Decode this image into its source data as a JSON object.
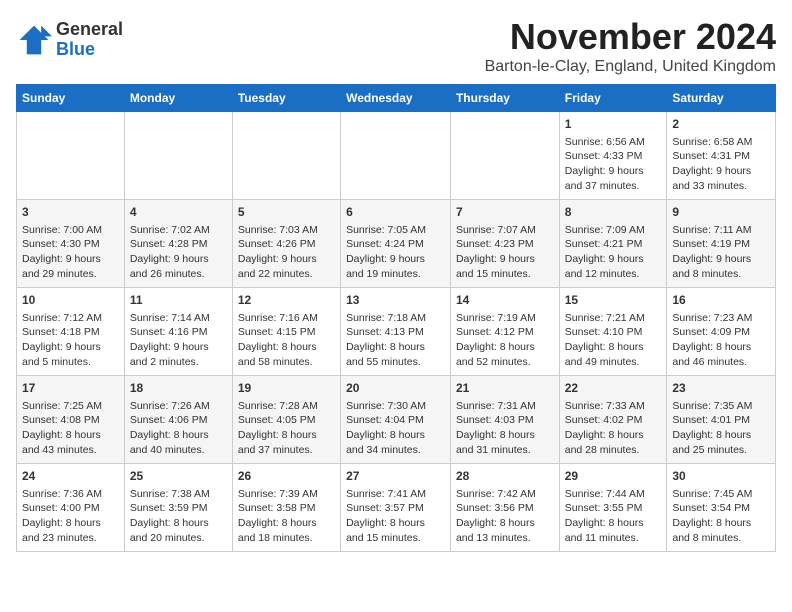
{
  "header": {
    "logo_general": "General",
    "logo_blue": "Blue",
    "month_title": "November 2024",
    "location": "Barton-le-Clay, England, United Kingdom"
  },
  "days_of_week": [
    "Sunday",
    "Monday",
    "Tuesday",
    "Wednesday",
    "Thursday",
    "Friday",
    "Saturday"
  ],
  "weeks": [
    [
      {
        "day": "",
        "info": ""
      },
      {
        "day": "",
        "info": ""
      },
      {
        "day": "",
        "info": ""
      },
      {
        "day": "",
        "info": ""
      },
      {
        "day": "",
        "info": ""
      },
      {
        "day": "1",
        "info": "Sunrise: 6:56 AM\nSunset: 4:33 PM\nDaylight: 9 hours and 37 minutes."
      },
      {
        "day": "2",
        "info": "Sunrise: 6:58 AM\nSunset: 4:31 PM\nDaylight: 9 hours and 33 minutes."
      }
    ],
    [
      {
        "day": "3",
        "info": "Sunrise: 7:00 AM\nSunset: 4:30 PM\nDaylight: 9 hours and 29 minutes."
      },
      {
        "day": "4",
        "info": "Sunrise: 7:02 AM\nSunset: 4:28 PM\nDaylight: 9 hours and 26 minutes."
      },
      {
        "day": "5",
        "info": "Sunrise: 7:03 AM\nSunset: 4:26 PM\nDaylight: 9 hours and 22 minutes."
      },
      {
        "day": "6",
        "info": "Sunrise: 7:05 AM\nSunset: 4:24 PM\nDaylight: 9 hours and 19 minutes."
      },
      {
        "day": "7",
        "info": "Sunrise: 7:07 AM\nSunset: 4:23 PM\nDaylight: 9 hours and 15 minutes."
      },
      {
        "day": "8",
        "info": "Sunrise: 7:09 AM\nSunset: 4:21 PM\nDaylight: 9 hours and 12 minutes."
      },
      {
        "day": "9",
        "info": "Sunrise: 7:11 AM\nSunset: 4:19 PM\nDaylight: 9 hours and 8 minutes."
      }
    ],
    [
      {
        "day": "10",
        "info": "Sunrise: 7:12 AM\nSunset: 4:18 PM\nDaylight: 9 hours and 5 minutes."
      },
      {
        "day": "11",
        "info": "Sunrise: 7:14 AM\nSunset: 4:16 PM\nDaylight: 9 hours and 2 minutes."
      },
      {
        "day": "12",
        "info": "Sunrise: 7:16 AM\nSunset: 4:15 PM\nDaylight: 8 hours and 58 minutes."
      },
      {
        "day": "13",
        "info": "Sunrise: 7:18 AM\nSunset: 4:13 PM\nDaylight: 8 hours and 55 minutes."
      },
      {
        "day": "14",
        "info": "Sunrise: 7:19 AM\nSunset: 4:12 PM\nDaylight: 8 hours and 52 minutes."
      },
      {
        "day": "15",
        "info": "Sunrise: 7:21 AM\nSunset: 4:10 PM\nDaylight: 8 hours and 49 minutes."
      },
      {
        "day": "16",
        "info": "Sunrise: 7:23 AM\nSunset: 4:09 PM\nDaylight: 8 hours and 46 minutes."
      }
    ],
    [
      {
        "day": "17",
        "info": "Sunrise: 7:25 AM\nSunset: 4:08 PM\nDaylight: 8 hours and 43 minutes."
      },
      {
        "day": "18",
        "info": "Sunrise: 7:26 AM\nSunset: 4:06 PM\nDaylight: 8 hours and 40 minutes."
      },
      {
        "day": "19",
        "info": "Sunrise: 7:28 AM\nSunset: 4:05 PM\nDaylight: 8 hours and 37 minutes."
      },
      {
        "day": "20",
        "info": "Sunrise: 7:30 AM\nSunset: 4:04 PM\nDaylight: 8 hours and 34 minutes."
      },
      {
        "day": "21",
        "info": "Sunrise: 7:31 AM\nSunset: 4:03 PM\nDaylight: 8 hours and 31 minutes."
      },
      {
        "day": "22",
        "info": "Sunrise: 7:33 AM\nSunset: 4:02 PM\nDaylight: 8 hours and 28 minutes."
      },
      {
        "day": "23",
        "info": "Sunrise: 7:35 AM\nSunset: 4:01 PM\nDaylight: 8 hours and 25 minutes."
      }
    ],
    [
      {
        "day": "24",
        "info": "Sunrise: 7:36 AM\nSunset: 4:00 PM\nDaylight: 8 hours and 23 minutes."
      },
      {
        "day": "25",
        "info": "Sunrise: 7:38 AM\nSunset: 3:59 PM\nDaylight: 8 hours and 20 minutes."
      },
      {
        "day": "26",
        "info": "Sunrise: 7:39 AM\nSunset: 3:58 PM\nDaylight: 8 hours and 18 minutes."
      },
      {
        "day": "27",
        "info": "Sunrise: 7:41 AM\nSunset: 3:57 PM\nDaylight: 8 hours and 15 minutes."
      },
      {
        "day": "28",
        "info": "Sunrise: 7:42 AM\nSunset: 3:56 PM\nDaylight: 8 hours and 13 minutes."
      },
      {
        "day": "29",
        "info": "Sunrise: 7:44 AM\nSunset: 3:55 PM\nDaylight: 8 hours and 11 minutes."
      },
      {
        "day": "30",
        "info": "Sunrise: 7:45 AM\nSunset: 3:54 PM\nDaylight: 8 hours and 8 minutes."
      }
    ]
  ]
}
